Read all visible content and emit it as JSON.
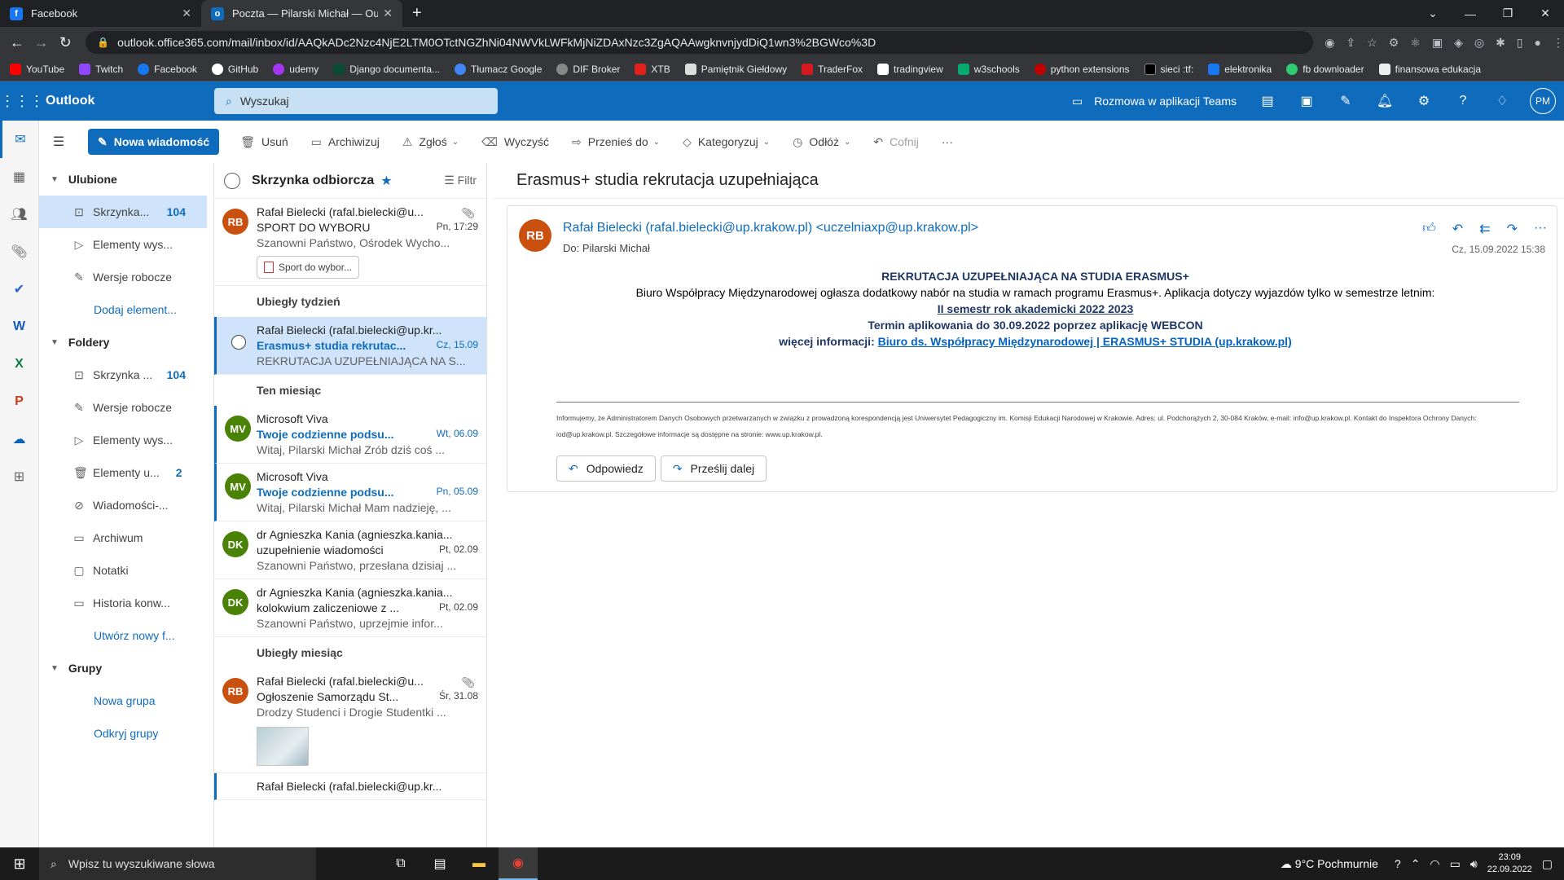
{
  "browser": {
    "tabs": [
      {
        "title": "Facebook",
        "active": false,
        "icon_color": "#1877f2",
        "icon_glyph": "f"
      },
      {
        "title": "Poczta — Pilarski Michał — Outlo",
        "active": true,
        "icon_color": "#0f6cbd",
        "icon_glyph": "o"
      }
    ],
    "url": "outlook.office365.com/mail/inbox/id/AAQkADc2Nzc4NjE2LTM0OTctNGZhNi04NWVkLWFkMjNiZDAxNzc3ZgAQAAwgknvnjydDiQ1wn3%2BGWco%3D",
    "bookmarks": [
      {
        "label": "YouTube",
        "color": "#ff0000"
      },
      {
        "label": "Twitch",
        "color": "#9146ff"
      },
      {
        "label": "Facebook",
        "color": "#1877f2"
      },
      {
        "label": "GitHub",
        "color": "#ffffff"
      },
      {
        "label": "udemy",
        "color": "#a435f0"
      },
      {
        "label": "Django documenta...",
        "color": "#0c4b33"
      },
      {
        "label": "Tłumacz Google",
        "color": "#4285f4"
      },
      {
        "label": "DIF Broker",
        "color": "#888888"
      },
      {
        "label": "XTB",
        "color": "#e0201b"
      },
      {
        "label": "Pamiętnik Giełdowy",
        "color": "#dddddd"
      },
      {
        "label": "TraderFox",
        "color": "#d71920"
      },
      {
        "label": "tradingview",
        "color": "#ffffff"
      },
      {
        "label": "w3schools",
        "color": "#04aa6d"
      },
      {
        "label": "python extensions",
        "color": "#c00000"
      },
      {
        "label": "sieci :tf:",
        "color": "#000000"
      },
      {
        "label": "elektronika",
        "color": "#1877f2"
      },
      {
        "label": "fb downloader",
        "color": "#2ecc71"
      },
      {
        "label": "finansowa edukacja",
        "color": "#eeeeee"
      }
    ]
  },
  "outlook": {
    "brand": "Outlook",
    "search_placeholder": "Wyszukaj",
    "teams_label": "Rozmowa w aplikacji Teams",
    "user_initials": "PM",
    "accent": "#0f6cbd",
    "commands": {
      "new_mail": "Nowa wiadomość",
      "delete": "Usuń",
      "archive": "Archiwizuj",
      "report": "Zgłoś",
      "sweep": "Wyczyść",
      "move": "Przenieś do",
      "categorize": "Kategoryzuj",
      "snooze": "Odłóż",
      "undo": "Cofnij",
      "more": "···"
    }
  },
  "folders": {
    "favorites_label": "Ulubione",
    "favorites": [
      {
        "label": "Skrzynka...",
        "count": "104",
        "icon": "inbox-icon",
        "selected": true
      },
      {
        "label": "Elementy wys...",
        "count": "",
        "icon": "send-icon"
      },
      {
        "label": "Wersje robocze",
        "count": "",
        "icon": "draft-icon"
      }
    ],
    "add_favorite": "Dodaj element...",
    "folders_label": "Foldery",
    "folders": [
      {
        "label": "Skrzynka ...",
        "count": "104",
        "icon": "inbox-icon"
      },
      {
        "label": "Wersje robocze",
        "count": "",
        "icon": "draft-icon"
      },
      {
        "label": "Elementy wys...",
        "count": "",
        "icon": "send-icon"
      },
      {
        "label": "Elementy u...",
        "count": "2",
        "icon": "trash-icon"
      },
      {
        "label": "Wiadomości-...",
        "count": "",
        "icon": "junk-icon"
      },
      {
        "label": "Archiwum",
        "count": "",
        "icon": "archive-icon"
      },
      {
        "label": "Notatki",
        "count": "",
        "icon": "note-icon"
      },
      {
        "label": "Historia konw...",
        "count": "",
        "icon": "folder-icon"
      }
    ],
    "new_folder": "Utwórz nowy f...",
    "groups_label": "Grupy",
    "new_group": "Nowa grupa",
    "discover_groups": "Odkryj grupy"
  },
  "list": {
    "title": "Skrzynka odbiorcza",
    "filter": "Filtr",
    "first_message": {
      "initials": "RB",
      "color": "#ca5010",
      "from": "Rafał Bielecki (rafal.bielecki@u...",
      "subject": "SPORT DO WYBORU",
      "date": "Pn, 17:29",
      "preview": "Szanowni Państwo, Ośrodek Wycho...",
      "attachment": "Sport do wybor..."
    },
    "group_last_week": "Ubiegły tydzień",
    "selected_message": {
      "from": "Rafał Bielecki (rafal.bielecki@up.kr...",
      "subject": "Erasmus+ studia rekrutac...",
      "date": "Cz, 15.09",
      "preview": "REKRUTACJA UZUPEŁNIAJĄCA NA S..."
    },
    "group_this_month": "Ten miesiąc",
    "month_messages": [
      {
        "initials": "MV",
        "color": "#498205",
        "from": "Microsoft Viva",
        "subject": "Twoje codzienne podsu...",
        "date": "Wt, 06.09",
        "preview": "Witaj, Pilarski Michał Zrób dziś coś ...",
        "unread": true
      },
      {
        "initials": "MV",
        "color": "#498205",
        "from": "Microsoft Viva",
        "subject": "Twoje codzienne podsu...",
        "date": "Pn, 05.09",
        "preview": "Witaj, Pilarski Michał Mam nadzieję, ...",
        "unread": true
      },
      {
        "initials": "DK",
        "color": "#498205",
        "from": "dr Agnieszka Kania (agnieszka.kania...",
        "subject": "uzupełnienie wiadomości",
        "date": "Pt, 02.09",
        "preview": "Szanowni Państwo, przesłana dzisiaj ...",
        "unread": false
      },
      {
        "initials": "DK",
        "color": "#498205",
        "from": "dr Agnieszka Kania (agnieszka.kania...",
        "subject": "kolokwium zaliczeniowe z ...",
        "date": "Pt, 02.09",
        "preview": "Szanowni Państwo, uprzejmie infor...",
        "unread": false
      }
    ],
    "group_last_month": "Ubiegły miesiąc",
    "last_month_message": {
      "initials": "RB",
      "color": "#ca5010",
      "from": "Rafał Bielecki (rafal.bielecki@u...",
      "subject": "Ogłoszenie Samorządu St...",
      "date": "Śr, 31.08",
      "preview": "Drodzy Studenci i Drogie Studentki ..."
    },
    "partial_message_from": "Rafał Bielecki (rafal.bielecki@up.kr..."
  },
  "reading": {
    "title": "Erasmus+ studia rekrutacja uzupełniająca",
    "sender": "Rafał Bielecki (rafal.bielecki@up.krakow.pl) <uczelniaxp@up.krakow.pl>",
    "initials": "RB",
    "to": "Do:  Pilarski Michał",
    "date": "Cz, 15.09.2022 15:38",
    "body_heading": "REKRUTACJA UZUPEŁNIAJĄCA NA STUDIA ERASMUS+",
    "body_line1": "Biuro Współpracy Międzynarodowej ogłasza dodatkowy nabór na studia w ramach programu Erasmus+.  Aplikacja dotyczy wyjazdów tylko w semestrze letnim:",
    "body_line2": "II semestr rok akademicki 2022 2023",
    "body_line3": "Termin aplikowania do 30.09.2022 poprzez aplikację WEBCON",
    "body_line4_prefix": "więcej informacji: ",
    "body_line4_link": " Biuro ds. Współpracy Międzynarodowej | ERASMUS+ STUDIA (up.krakow.pl)",
    "disclaimer": "Informujemy, że Administratorem Danych Osobowych przetwarzanych w związku z prowadzoną korespondencją jest Uniwersytet Pedagogiczny im. Komisji Edukacji Narodowej w Krakowie. Adres: ul. Podchorążych 2, 30-084 Kraków, e-mail: info@up.krakow.pl. Kontakt do Inspektora Ochrony Danych: iod@up.krakow.pl. Szczegółowe informacje są dostępne na stronie: www.up.krakow.pl.",
    "reply": "Odpowiedz",
    "forward": "Prześlij dalej"
  },
  "taskbar": {
    "search_placeholder": "Wpisz tu wyszukiwane słowa",
    "weather": "9°C  Pochmurnie",
    "time": "23:09",
    "date": "22.09.2022"
  }
}
